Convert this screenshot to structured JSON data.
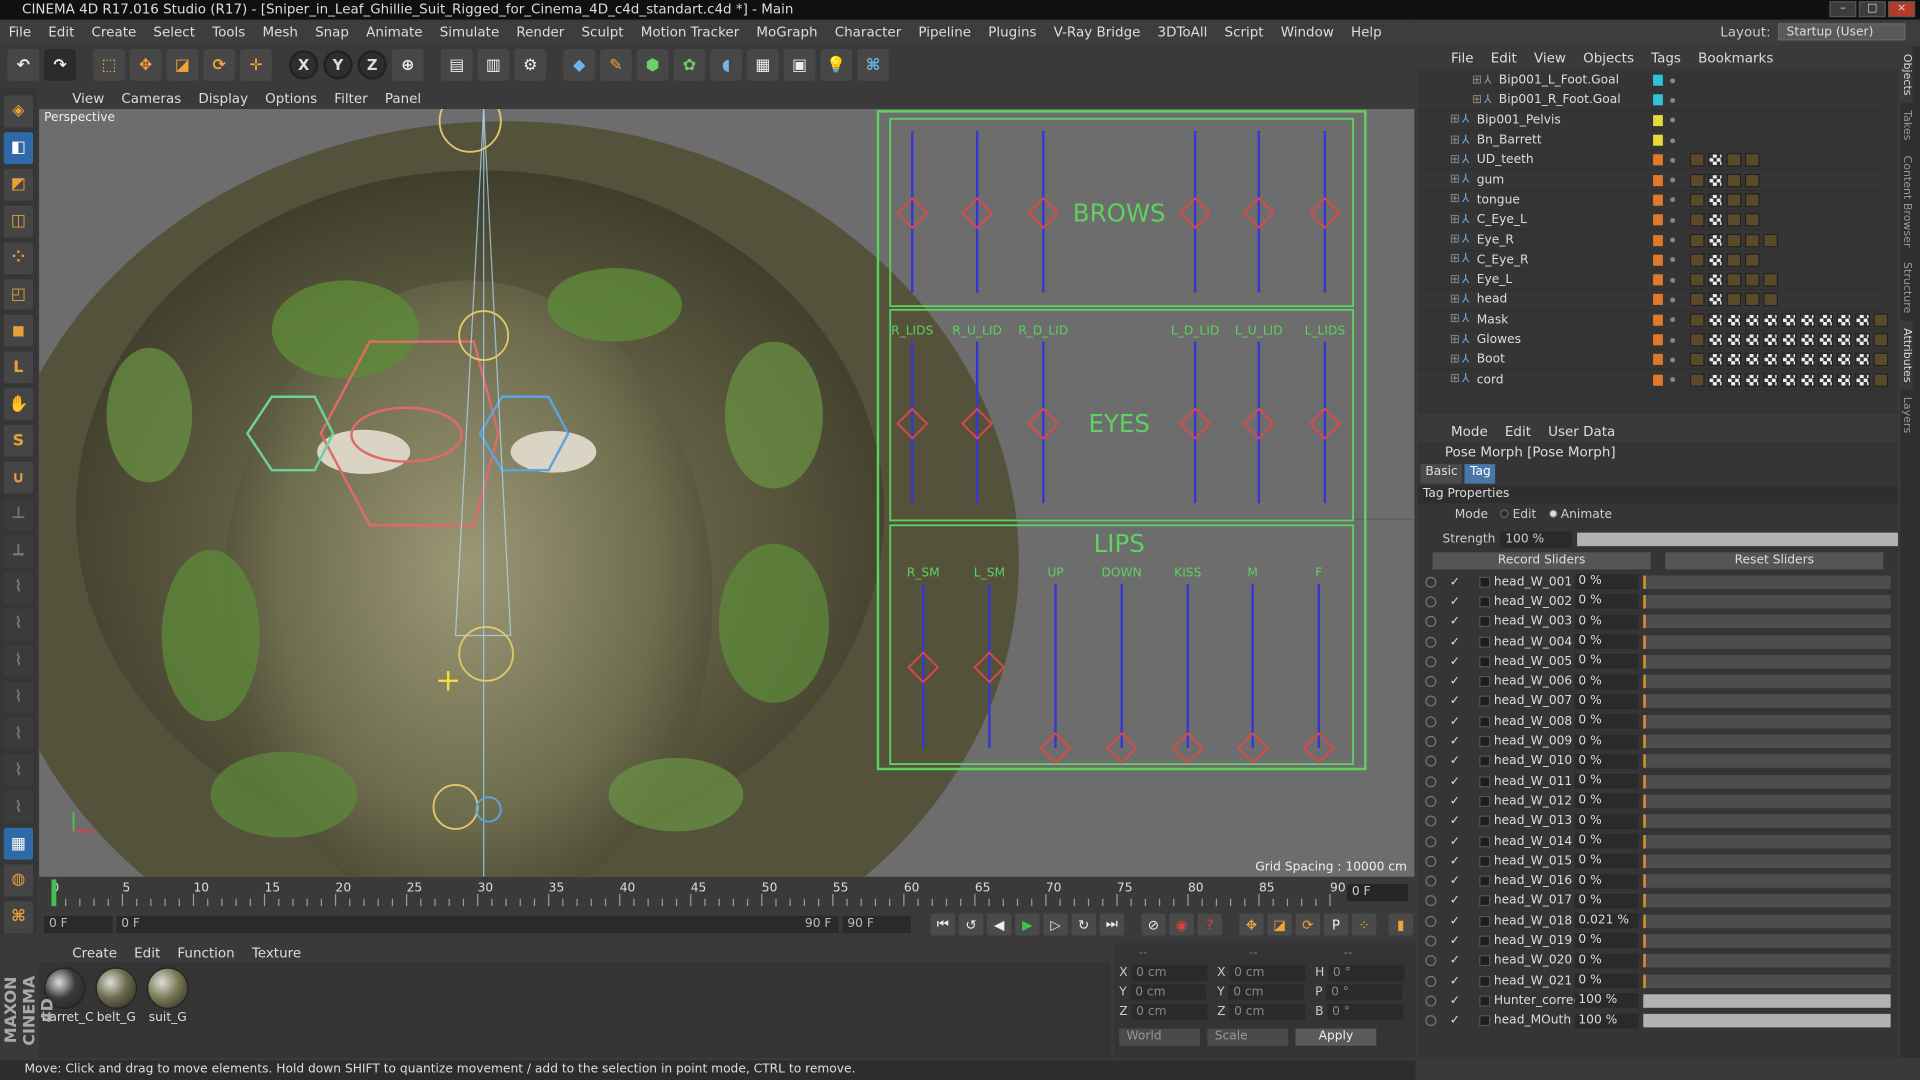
{
  "window": {
    "title": "CINEMA 4D R17.016 Studio (R17) - [Sniper_in_Leaf_Ghillie_Suit_Rigged_for_Cinema_4D_c4d_standart.c4d *] - Main"
  },
  "menu": [
    "File",
    "Edit",
    "Create",
    "Select",
    "Tools",
    "Mesh",
    "Snap",
    "Animate",
    "Simulate",
    "Render",
    "Sculpt",
    "Motion Tracker",
    "MoGraph",
    "Character",
    "Pipeline",
    "Plugins",
    "V-Ray Bridge",
    "3DToAll",
    "Script",
    "Window",
    "Help"
  ],
  "layout": {
    "label": "Layout:",
    "value": "Startup (User)"
  },
  "toolbar": {
    "axis_x": "X",
    "axis_y": "Y",
    "axis_z": "Z"
  },
  "viewport": {
    "menu": [
      "View",
      "Cameras",
      "Display",
      "Options",
      "Filter",
      "Panel"
    ],
    "camera_label": "Perspective",
    "grid_spacing": "Grid Spacing : 10000 cm",
    "overlay": {
      "brows": "BROWS",
      "eyes": "EYES",
      "lips": "LIPS",
      "eye_labels": [
        "R_LIDS",
        "R_U_LID",
        "R_D_LID",
        "L_D_LID",
        "L_U_LID",
        "L_LIDS"
      ],
      "lip_labels": [
        "R_SM",
        "L_SM",
        "UP",
        "DOWN",
        "KISS",
        "M",
        "F"
      ]
    }
  },
  "timeline": {
    "ticks": [
      "0",
      "5",
      "10",
      "15",
      "20",
      "25",
      "30",
      "35",
      "40",
      "45",
      "50",
      "55",
      "60",
      "65",
      "70",
      "75",
      "80",
      "85",
      "90"
    ],
    "current_frame": "0 F",
    "start": "0 F",
    "range_start": "0 F",
    "range_end": "90 F",
    "end": "90 F"
  },
  "materials": {
    "menu": [
      "Create",
      "Edit",
      "Function",
      "Texture"
    ],
    "items": [
      {
        "name": "barret_C",
        "color": "#3a3a3a"
      },
      {
        "name": "belt_G",
        "color": "#6b6b4a"
      },
      {
        "name": "suit_G",
        "color": "#7a7a55"
      }
    ]
  },
  "coords": {
    "rows": [
      {
        "a": "X",
        "av": "0 cm",
        "b": "X",
        "bv": "0 cm",
        "c": "H",
        "cv": "0 °"
      },
      {
        "a": "Y",
        "av": "0 cm",
        "b": "Y",
        "bv": "0 cm",
        "c": "P",
        "cv": "0 °"
      },
      {
        "a": "Z",
        "av": "0 cm",
        "b": "Z",
        "bv": "0 cm",
        "c": "B",
        "cv": "0 °"
      }
    ],
    "world": "World",
    "scale": "Scale",
    "apply": "Apply"
  },
  "status": "Move: Click and drag to move elements. Hold down SHIFT to quantize movement / add to the selection in point mode, CTRL to remove.",
  "brand": "MAXON CINEMA 4D",
  "objects": {
    "menu": [
      "File",
      "Edit",
      "View",
      "Objects",
      "Tags",
      "Bookmarks"
    ],
    "rows": [
      {
        "name": "Bip001_L_Foot.Goal",
        "indent": 62,
        "color": "#2ec4d8",
        "tags": 0,
        "chk": 0
      },
      {
        "name": "Bip001_R_Foot.Goal",
        "indent": 62,
        "color": "#2ec4d8",
        "tags": 0,
        "chk": 0
      },
      {
        "name": "Bip001_Pelvis",
        "indent": 44,
        "color": "#e6d93a",
        "tags": 0,
        "chk": 0
      },
      {
        "name": "Bn_Barrett",
        "indent": 44,
        "color": "#e6d93a",
        "tags": 0,
        "chk": 0
      },
      {
        "name": "UD_teeth",
        "indent": 44,
        "color": "#e07a2a",
        "tags": 4,
        "chk": 1
      },
      {
        "name": "gum",
        "indent": 44,
        "color": "#e07a2a",
        "tags": 4,
        "chk": 1
      },
      {
        "name": "tongue",
        "indent": 44,
        "color": "#e07a2a",
        "tags": 4,
        "chk": 1
      },
      {
        "name": "C_Eye_L",
        "indent": 44,
        "color": "#e07a2a",
        "tags": 4,
        "chk": 1
      },
      {
        "name": "Eye_R",
        "indent": 44,
        "color": "#e07a2a",
        "tags": 5,
        "chk": 1
      },
      {
        "name": "C_Eye_R",
        "indent": 44,
        "color": "#e07a2a",
        "tags": 4,
        "chk": 1
      },
      {
        "name": "Eye_L",
        "indent": 44,
        "color": "#e07a2a",
        "tags": 5,
        "chk": 1
      },
      {
        "name": "head",
        "indent": 44,
        "color": "#e07a2a",
        "tags": 5,
        "chk": 1
      },
      {
        "name": "Mask",
        "indent": 44,
        "color": "#e07a2a",
        "tags": 11,
        "chk": 9
      },
      {
        "name": "Glowes",
        "indent": 44,
        "color": "#e07a2a",
        "tags": 11,
        "chk": 9
      },
      {
        "name": "Boot",
        "indent": 44,
        "color": "#e07a2a",
        "tags": 11,
        "chk": 9
      },
      {
        "name": "cord",
        "indent": 44,
        "color": "#e07a2a",
        "tags": 11,
        "chk": 9
      }
    ]
  },
  "attributes": {
    "menu": [
      "Mode",
      "Edit",
      "User Data"
    ],
    "title": "Pose Morph [Pose Morph]",
    "tabs": [
      "Basic",
      "Tag"
    ],
    "section": "Tag Properties",
    "mode_label": "Mode",
    "mode_edit": "Edit",
    "mode_animate": "Animate",
    "strength_label": "Strength",
    "strength_value": "100 %",
    "strength_level": 1.0,
    "record": "Record Sliders",
    "reset": "Reset Sliders",
    "sliders": [
      {
        "name": "head_W_001",
        "value": "0 %",
        "level": 0
      },
      {
        "name": "head_W_002",
        "value": "0 %",
        "level": 0
      },
      {
        "name": "head_W_003",
        "value": "0 %",
        "level": 0
      },
      {
        "name": "head_W_004",
        "value": "0 %",
        "level": 0
      },
      {
        "name": "head_W_005",
        "value": "0 %",
        "level": 0
      },
      {
        "name": "head_W_006",
        "value": "0 %",
        "level": 0
      },
      {
        "name": "head_W_007",
        "value": "0 %",
        "level": 0
      },
      {
        "name": "head_W_008",
        "value": "0 %",
        "level": 0
      },
      {
        "name": "head_W_009",
        "value": "0 %",
        "level": 0
      },
      {
        "name": "head_W_010",
        "value": "0 %",
        "level": 0
      },
      {
        "name": "head_W_011",
        "value": "0 %",
        "level": 0
      },
      {
        "name": "head_W_012",
        "value": "0 %",
        "level": 0
      },
      {
        "name": "head_W_013",
        "value": "0 %",
        "level": 0
      },
      {
        "name": "head_W_014",
        "value": "0 %",
        "level": 0
      },
      {
        "name": "head_W_015",
        "value": "0 %",
        "level": 0
      },
      {
        "name": "head_W_016",
        "value": "0 %",
        "level": 0
      },
      {
        "name": "head_W_017",
        "value": "0 %",
        "level": 0
      },
      {
        "name": "head_W_018",
        "value": "0.021 %",
        "level": 0.0002
      },
      {
        "name": "head_W_019",
        "value": "0 %",
        "level": 0
      },
      {
        "name": "head_W_020",
        "value": "0 %",
        "level": 0
      },
      {
        "name": "head_W_021",
        "value": "0 %",
        "level": 0
      },
      {
        "name": "Hunter_correct",
        "value": "100 %",
        "level": 1
      },
      {
        "name": "head_MOuth",
        "value": "100 %",
        "level": 1
      }
    ]
  },
  "side_tabs": [
    "Objects",
    "Takes",
    "Content Browser",
    "Structure",
    "Attributes",
    "Layers"
  ]
}
